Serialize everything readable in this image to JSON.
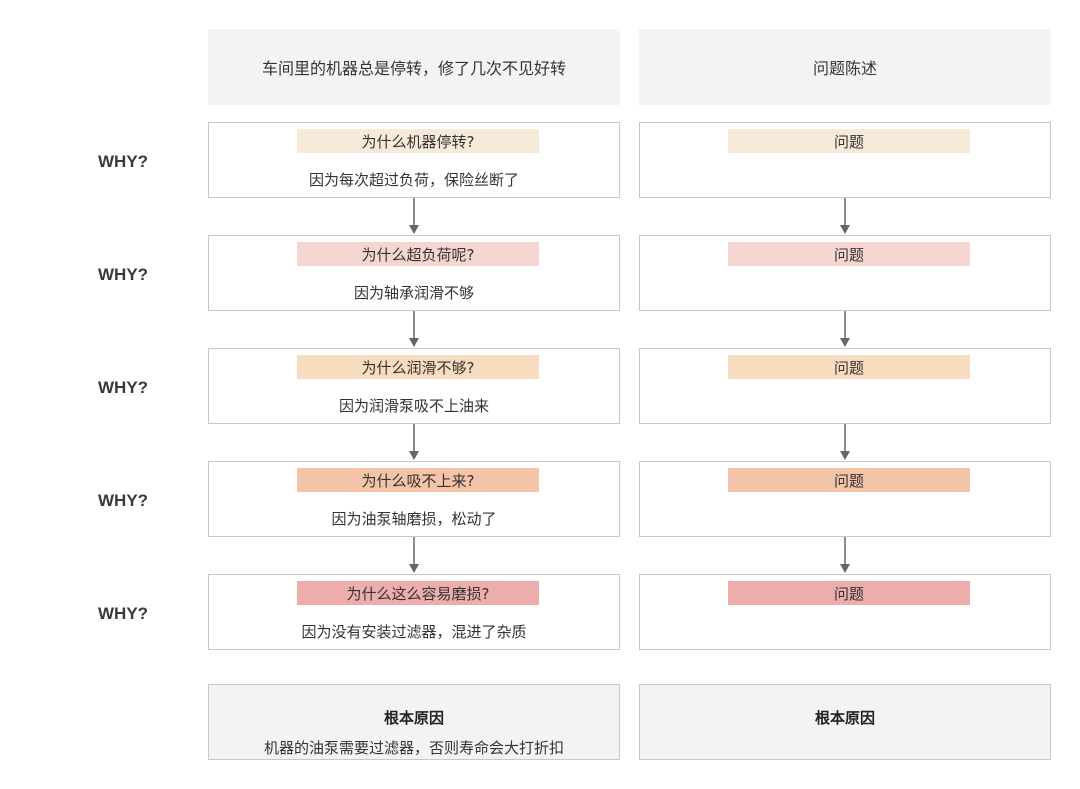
{
  "header": {
    "left": "车间里的机器总是停转，修了几次不见好转",
    "right": "问题陈述"
  },
  "why_label": "WHY?",
  "steps": [
    {
      "question": "为什么机器停转?",
      "answer": "因为每次超过负荷，保险丝断了",
      "right_label": "问题",
      "color": "#f8ead9"
    },
    {
      "question": "为什么超负荷呢?",
      "answer": "因为轴承润滑不够",
      "right_label": "问题",
      "color": "#f6d6d0"
    },
    {
      "question": "为什么润滑不够?",
      "answer": "因为润滑泵吸不上油来",
      "right_label": "问题",
      "color": "#f8dcc0"
    },
    {
      "question": "为什么吸不上来?",
      "answer": "因为油泵轴磨损，松动了",
      "right_label": "问题",
      "color": "#f3c4a8"
    },
    {
      "question": "为什么这么容易磨损?",
      "answer": "因为没有安装过滤器，混进了杂质",
      "right_label": "问题",
      "color": "#ecadab"
    }
  ],
  "root": {
    "left_title": "根本原因",
    "left_text": "机器的油泵需要过滤器，否则寿命会大打折扣",
    "right_title": "根本原因"
  },
  "colors": {
    "border": "#c8c8c8",
    "header_bg": "#f3f3f3",
    "arrow": "#666666"
  }
}
